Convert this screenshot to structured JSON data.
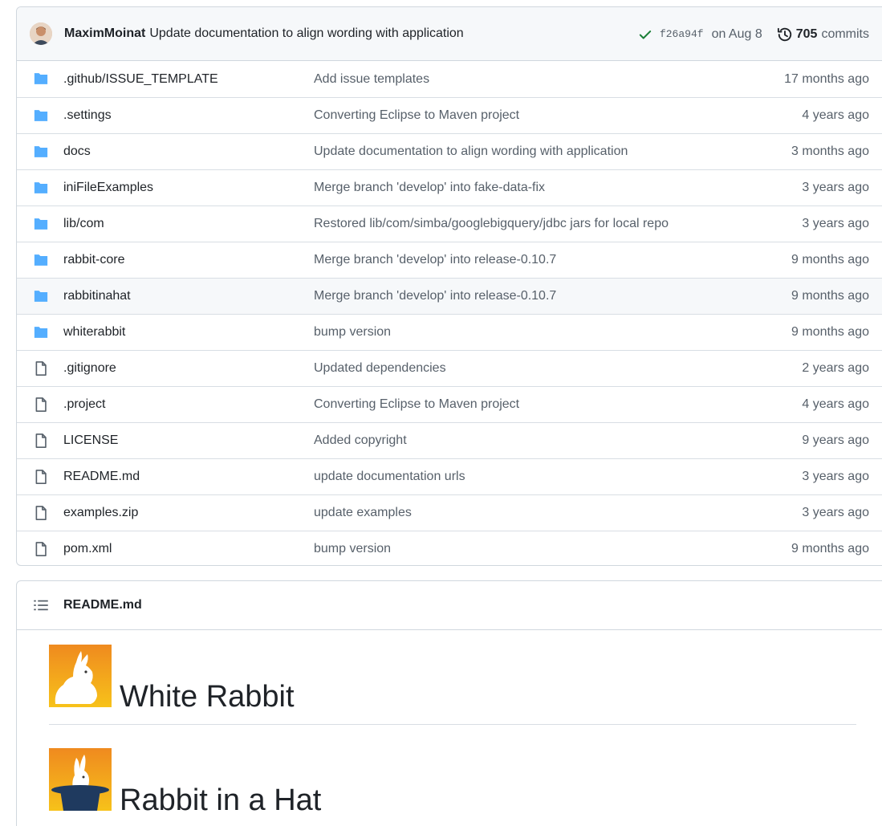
{
  "commit": {
    "author": "MaximMoinat",
    "message": "Update documentation to align wording with application",
    "sha": "f26a94f",
    "date": "on Aug 8",
    "count": "705",
    "count_label": "commits"
  },
  "files": [
    {
      "type": "folder",
      "name": ".github/ISSUE_TEMPLATE",
      "message": "Add issue templates",
      "age": "17 months ago"
    },
    {
      "type": "folder",
      "name": ".settings",
      "message": "Converting Eclipse to Maven project",
      "age": "4 years ago"
    },
    {
      "type": "folder",
      "name": "docs",
      "message": "Update documentation to align wording with application",
      "age": "3 months ago"
    },
    {
      "type": "folder",
      "name": "iniFileExamples",
      "message": "Merge branch 'develop' into fake-data-fix",
      "age": "3 years ago"
    },
    {
      "type": "folder",
      "name": "lib/com",
      "message": "Restored lib/com/simba/googlebigquery/jdbc jars for local repo",
      "age": "3 years ago"
    },
    {
      "type": "folder",
      "name": "rabbit-core",
      "message": "Merge branch 'develop' into release-0.10.7",
      "age": "9 months ago"
    },
    {
      "type": "folder",
      "name": "rabbitinahat",
      "message": "Merge branch 'develop' into release-0.10.7",
      "age": "9 months ago"
    },
    {
      "type": "folder",
      "name": "whiterabbit",
      "message": "bump version",
      "age": "9 months ago"
    },
    {
      "type": "file",
      "name": ".gitignore",
      "message": "Updated dependencies",
      "age": "2 years ago"
    },
    {
      "type": "file",
      "name": ".project",
      "message": "Converting Eclipse to Maven project",
      "age": "4 years ago"
    },
    {
      "type": "file",
      "name": "LICENSE",
      "message": "Added copyright",
      "age": "9 years ago"
    },
    {
      "type": "file",
      "name": "README.md",
      "message": "update documentation urls",
      "age": "3 years ago"
    },
    {
      "type": "file",
      "name": "examples.zip",
      "message": "update examples",
      "age": "3 years ago"
    },
    {
      "type": "file",
      "name": "pom.xml",
      "message": "bump version",
      "age": "9 months ago"
    }
  ],
  "readme": {
    "title": "README.md",
    "headings": [
      "White Rabbit",
      "Rabbit in a Hat"
    ]
  },
  "colors": {
    "folder": "#54aeff",
    "file_icon": "#57606a",
    "check": "#1a7f37",
    "logo_orange": "#f39c12"
  }
}
